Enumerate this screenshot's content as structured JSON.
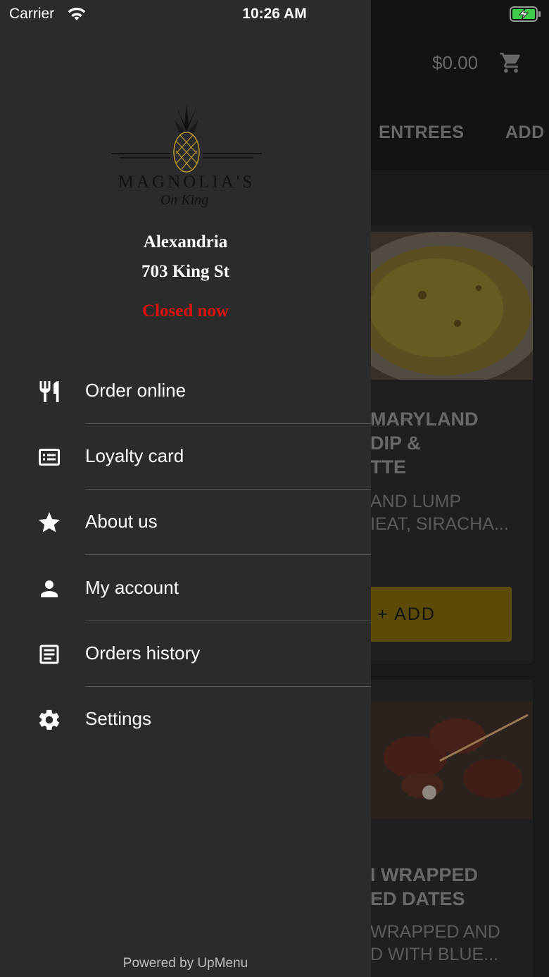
{
  "status_bar": {
    "carrier": "Carrier",
    "time": "10:26 AM"
  },
  "background": {
    "cart_total": "$0.00",
    "tabs": [
      "ENTREES",
      "ADD"
    ],
    "cards": [
      {
        "title_lines": [
          "MARYLAND",
          "DIP &",
          "TTE"
        ],
        "desc_lines": [
          "AND LUMP",
          "IEAT, SIRACHA..."
        ],
        "add_label": "+ ADD"
      },
      {
        "title_lines": [
          "I WRAPPED",
          "ED DATES"
        ],
        "desc_lines": [
          "WRAPPED AND",
          "D WITH BLUE..."
        ]
      }
    ]
  },
  "restaurant": {
    "logo_name": "MAGNOLIA'S",
    "logo_sub": "On King",
    "city": "Alexandria",
    "street": "703 King St",
    "status": "Closed now"
  },
  "menu": [
    {
      "label": "Order online",
      "icon": "utensils-icon"
    },
    {
      "label": "Loyalty card",
      "icon": "card-icon"
    },
    {
      "label": "About us",
      "icon": "star-icon"
    },
    {
      "label": "My account",
      "icon": "person-icon"
    },
    {
      "label": "Orders history",
      "icon": "document-icon"
    },
    {
      "label": "Settings",
      "icon": "gear-icon"
    }
  ],
  "footer": {
    "powered_by": "Powered by UpMenu"
  },
  "colors": {
    "closed": "#e01010",
    "drawer_bg": "#2b2b2b",
    "add_button": "#7a6508"
  }
}
